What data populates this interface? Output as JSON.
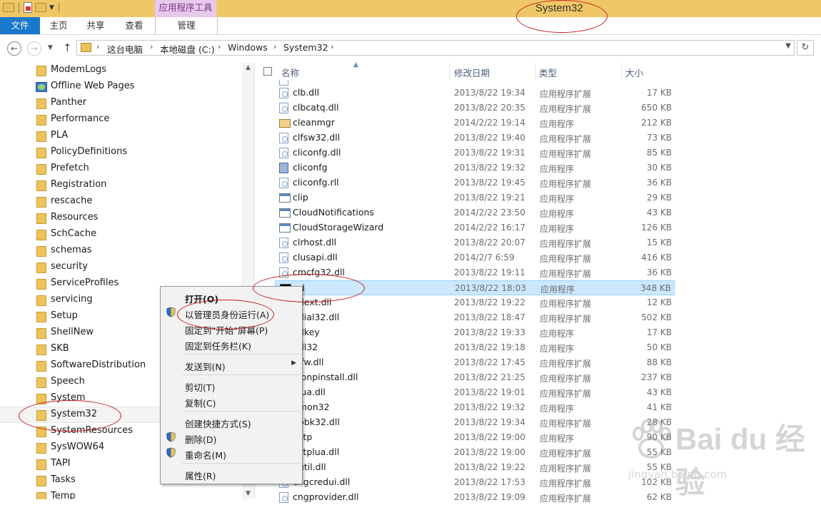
{
  "window": {
    "title": "System32"
  },
  "ribbon": {
    "contextual_group": "应用程序工具",
    "tabs": [
      {
        "label": "文件",
        "active": true
      },
      {
        "label": "主页"
      },
      {
        "label": "共享"
      },
      {
        "label": "查看"
      },
      {
        "label": "管理"
      }
    ]
  },
  "address": {
    "crumbs": [
      "这台电脑",
      "本地磁盘 (C:)",
      "Windows",
      "System32"
    ]
  },
  "nav_pane": {
    "items": [
      "ModemLogs",
      "Offline Web Pages",
      "Panther",
      "Performance",
      "PLA",
      "PolicyDefinitions",
      "Prefetch",
      "Registration",
      "rescache",
      "Resources",
      "SchCache",
      "schemas",
      "security",
      "ServiceProfiles",
      "servicing",
      "Setup",
      "ShellNew",
      "SKB",
      "SoftwareDistribution",
      "Speech",
      "System",
      "System32",
      "SystemResources",
      "SysWOW64",
      "TAPI",
      "Tasks",
      "Temp"
    ],
    "selected": "System32"
  },
  "file_list": {
    "columns": {
      "name": "名称",
      "modified": "修改日期",
      "type": "类型",
      "size": "大小"
    },
    "rows": [
      {
        "name": "clb.dll",
        "date": "2013/8/22 19:34",
        "type": "应用程序扩展",
        "size": "17 KB",
        "icon": "dll"
      },
      {
        "name": "clbcatq.dll",
        "date": "2013/8/22 20:35",
        "type": "应用程序扩展",
        "size": "650 KB",
        "icon": "dll"
      },
      {
        "name": "cleanmgr",
        "date": "2014/2/22 19:14",
        "type": "应用程序",
        "size": "212 KB",
        "icon": "broom"
      },
      {
        "name": "clfsw32.dll",
        "date": "2013/8/22 19:40",
        "type": "应用程序扩展",
        "size": "73 KB",
        "icon": "dll"
      },
      {
        "name": "cliconfg.dll",
        "date": "2013/8/22 19:31",
        "type": "应用程序扩展",
        "size": "85 KB",
        "icon": "dll"
      },
      {
        "name": "cliconfg",
        "date": "2013/8/22 19:32",
        "type": "应用程序",
        "size": "30 KB",
        "icon": "cfg"
      },
      {
        "name": "cliconfg.rll",
        "date": "2013/8/22 19:45",
        "type": "应用程序扩展",
        "size": "36 KB",
        "icon": "dll"
      },
      {
        "name": "clip",
        "date": "2013/8/22 19:21",
        "type": "应用程序",
        "size": "29 KB",
        "icon": "exe"
      },
      {
        "name": "CloudNotifications",
        "date": "2014/2/22 23:50",
        "type": "应用程序",
        "size": "43 KB",
        "icon": "exe"
      },
      {
        "name": "CloudStorageWizard",
        "date": "2014/2/22 16:17",
        "type": "应用程序",
        "size": "126 KB",
        "icon": "exe"
      },
      {
        "name": "clrhost.dll",
        "date": "2013/8/22 20:07",
        "type": "应用程序扩展",
        "size": "15 KB",
        "icon": "dll"
      },
      {
        "name": "clusapi.dll",
        "date": "2014/2/7 6:59",
        "type": "应用程序扩展",
        "size": "416 KB",
        "icon": "dll"
      },
      {
        "name": "cmcfg32.dll",
        "date": "2013/8/22 19:11",
        "type": "应用程序扩展",
        "size": "36 KB",
        "icon": "dll"
      },
      {
        "name": "nd",
        "date": "2013/8/22 18:03",
        "type": "应用程序",
        "size": "348 KB",
        "icon": "cmd",
        "selected": true
      },
      {
        "name": "ndext.dll",
        "date": "2013/8/22 19:22",
        "type": "应用程序扩展",
        "size": "12 KB",
        "icon": "dll"
      },
      {
        "name": "ndial32.dll",
        "date": "2013/8/22 18:47",
        "type": "应用程序扩展",
        "size": "502 KB",
        "icon": "dll"
      },
      {
        "name": "ndkey",
        "date": "2013/8/22 19:33",
        "type": "应用程序",
        "size": "17 KB",
        "icon": "exe"
      },
      {
        "name": "ndl32",
        "date": "2013/8/22 19:18",
        "type": "应用程序",
        "size": "50 KB",
        "icon": "exe"
      },
      {
        "name": "nifw.dll",
        "date": "2013/8/22 17:45",
        "type": "应用程序扩展",
        "size": "88 KB",
        "icon": "dll"
      },
      {
        "name": "nipnpinstall.dll",
        "date": "2013/8/22 21:25",
        "type": "应用程序扩展",
        "size": "237 KB",
        "icon": "dll"
      },
      {
        "name": "nlua.dll",
        "date": "2013/8/22 19:01",
        "type": "应用程序扩展",
        "size": "43 KB",
        "icon": "dll"
      },
      {
        "name": "nmon32",
        "date": "2013/8/22 19:32",
        "type": "应用程序",
        "size": "41 KB",
        "icon": "exe"
      },
      {
        "name": "npbk32.dll",
        "date": "2013/8/22 19:34",
        "type": "应用程序扩展",
        "size": "28 KB",
        "icon": "dll"
      },
      {
        "name": "nstp",
        "date": "2013/8/22 19:00",
        "type": "应用程序",
        "size": "90 KB",
        "icon": "exe"
      },
      {
        "name": "nstplua.dll",
        "date": "2013/8/22 19:00",
        "type": "应用程序扩展",
        "size": "55 KB",
        "icon": "dll"
      },
      {
        "name": "nutil.dll",
        "date": "2013/8/22 19:22",
        "type": "应用程序扩展",
        "size": "55 KB",
        "icon": "dll"
      },
      {
        "name": "cngcredui.dll",
        "date": "2013/8/22 17:53",
        "type": "应用程序扩展",
        "size": "102 KB",
        "icon": "dll"
      },
      {
        "name": "cngprovider.dll",
        "date": "2013/8/22 19:09",
        "type": "应用程序扩展",
        "size": "62 KB",
        "icon": "dll"
      }
    ]
  },
  "context_menu": {
    "items": [
      {
        "label": "打开(O)",
        "bold": true
      },
      {
        "label": "以管理员身份运行(A)",
        "shield": true
      },
      {
        "label": "固定到\"开始\"屏幕(P)"
      },
      {
        "label": "固定到任务栏(K)"
      },
      {
        "label": "发送到(N)",
        "submenu": true
      },
      {
        "label": "剪切(T)"
      },
      {
        "label": "复制(C)"
      },
      {
        "label": "创建快捷方式(S)"
      },
      {
        "label": "删除(D)",
        "shield": true
      },
      {
        "label": "重命名(M)",
        "shield": true
      },
      {
        "label": "属性(R)"
      }
    ]
  },
  "watermark": {
    "brand": "Bai du 经验",
    "url": "jingyan.baidu.com"
  },
  "colors": {
    "title_bar": "#f0c766",
    "file_tab": "#1979ca",
    "app_tools_tab": "#e7c9ec",
    "selection": "#cce8ff",
    "annotation": "#c41e1e"
  }
}
